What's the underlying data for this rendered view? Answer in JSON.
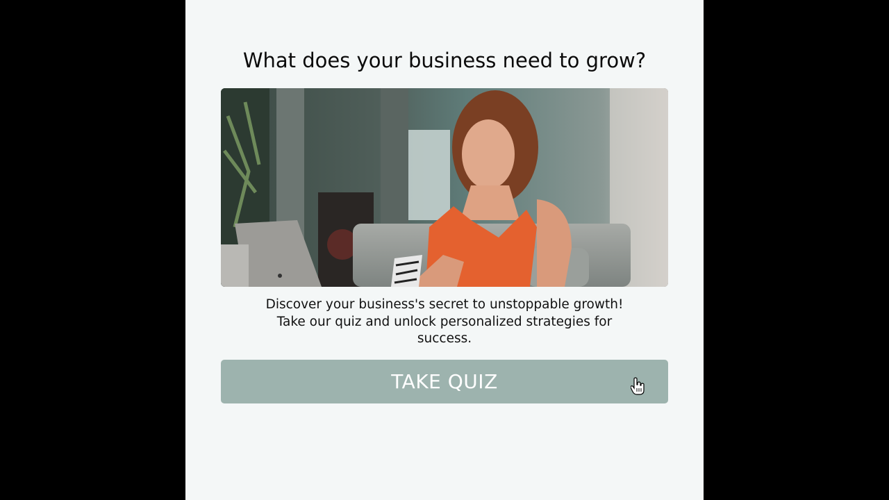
{
  "page": {
    "title": "What does your business need to grow?",
    "description_lines": [
      "Discover your business's secret to unstoppable growth!",
      "Take our quiz and unlock personalized strategies for",
      "success."
    ],
    "cta_label": "TAKE QUIZ"
  },
  "colors": {
    "letterbox": "#000000",
    "panel_background": "#f4f7f7",
    "button_background": "#9db3ae",
    "button_text": "#ffffff",
    "title_text": "#0b0b0b"
  },
  "icons": {
    "cursor": "hand-pointer-cursor-icon"
  }
}
